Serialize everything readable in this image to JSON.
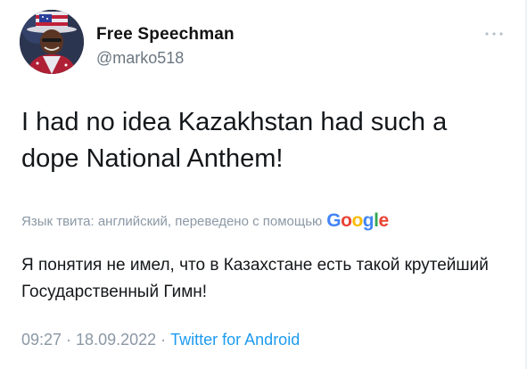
{
  "user": {
    "display_name": "Free Speechman",
    "handle": "@marko518"
  },
  "menu": {
    "more_icon": "more-dots-icon"
  },
  "tweet": {
    "text": "I had no idea Kazakhstan had such a dope National Anthem!"
  },
  "translation": {
    "label": "Язык твита: английский, переведено с помощью",
    "provider_letters": [
      {
        "char": "G",
        "color": "#4285f4"
      },
      {
        "char": "o",
        "color": "#ea4335"
      },
      {
        "char": "o",
        "color": "#fbbc05"
      },
      {
        "char": "g",
        "color": "#4285f4"
      },
      {
        "char": "l",
        "color": "#34a853"
      },
      {
        "char": "e",
        "color": "#ea4335"
      }
    ],
    "text": "Я понятия не имел, что в Казахстане есть такой крутейший Государственный Гимн!"
  },
  "meta": {
    "time": "09:27",
    "separator": "·",
    "date": "18.09.2022",
    "source": "Twitter for Android"
  },
  "colors": {
    "link": "#1d9bf0",
    "muted": "#8b98a5",
    "text": "#14171a"
  }
}
